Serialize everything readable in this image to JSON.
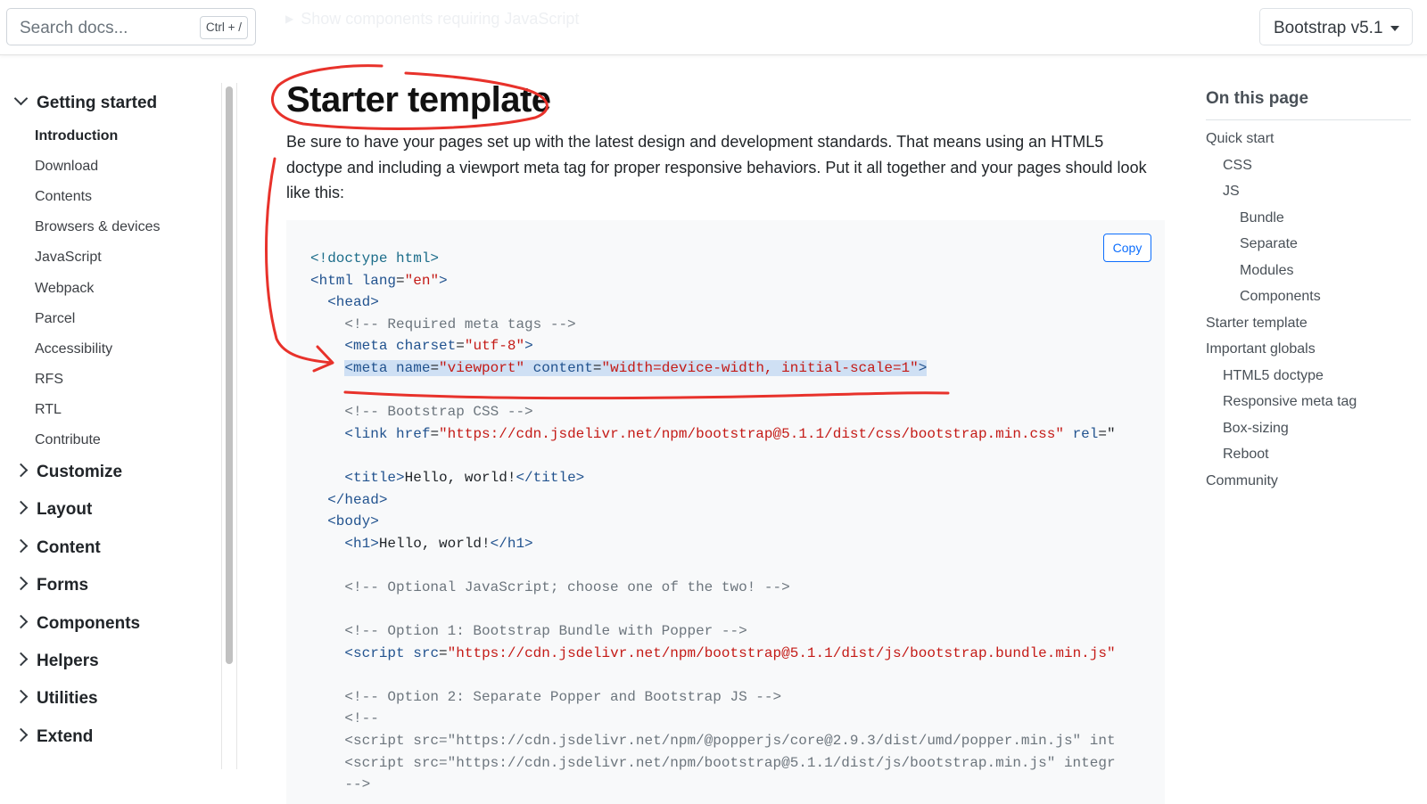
{
  "header": {
    "search_placeholder": "Search docs...",
    "search_shortcut": "Ctrl + /",
    "faded_link": "Show components requiring JavaScript",
    "version_label": "Bootstrap v5.1"
  },
  "sidebar": {
    "open_group": "Getting started",
    "items": [
      "Introduction",
      "Download",
      "Contents",
      "Browsers & devices",
      "JavaScript",
      "Webpack",
      "Parcel",
      "Accessibility",
      "RFS",
      "RTL",
      "Contribute"
    ],
    "active_item": "Introduction",
    "groups": [
      "Customize",
      "Layout",
      "Content",
      "Forms",
      "Components",
      "Helpers",
      "Utilities",
      "Extend"
    ]
  },
  "main": {
    "title": "Starter template",
    "intro": "Be sure to have your pages set up with the latest design and development standards. That means using an HTML5 doctype and including a viewport meta tag for proper responsive behaviors. Put it all together and your pages should look like this:",
    "copy_label": "Copy",
    "code_lines": [
      [
        {
          "t": "dt",
          "v": "<!doctype html>"
        }
      ],
      [
        {
          "t": "tg",
          "v": "<html"
        },
        {
          "t": "p",
          "v": " "
        },
        {
          "t": "at",
          "v": "lang"
        },
        {
          "t": "p",
          "v": "="
        },
        {
          "t": "st",
          "v": "\"en\""
        },
        {
          "t": "tg",
          "v": ">"
        }
      ],
      [
        {
          "t": "p",
          "v": "  "
        },
        {
          "t": "tg",
          "v": "<head>"
        }
      ],
      [
        {
          "t": "p",
          "v": "    "
        },
        {
          "t": "cm",
          "v": "<!-- Required meta tags -->"
        }
      ],
      [
        {
          "t": "p",
          "v": "    "
        },
        {
          "t": "tg",
          "v": "<meta"
        },
        {
          "t": "p",
          "v": " "
        },
        {
          "t": "at",
          "v": "charset"
        },
        {
          "t": "p",
          "v": "="
        },
        {
          "t": "st",
          "v": "\"utf-8\""
        },
        {
          "t": "tg",
          "v": ">"
        }
      ],
      [
        {
          "t": "p",
          "v": "    "
        },
        {
          "t": "tg",
          "v": "<meta",
          "h": 1
        },
        {
          "t": "p",
          "v": " ",
          "h": 1
        },
        {
          "t": "at",
          "v": "name",
          "h": 1
        },
        {
          "t": "p",
          "v": "=",
          "h": 1
        },
        {
          "t": "st",
          "v": "\"viewport\"",
          "h": 1
        },
        {
          "t": "p",
          "v": " ",
          "h": 1
        },
        {
          "t": "at",
          "v": "content",
          "h": 1
        },
        {
          "t": "p",
          "v": "=",
          "h": 1
        },
        {
          "t": "st",
          "v": "\"width=device-width, initial-scale=1\"",
          "h": 1
        },
        {
          "t": "tg",
          "v": ">",
          "h": 1
        }
      ],
      [],
      [
        {
          "t": "p",
          "v": "    "
        },
        {
          "t": "cm",
          "v": "<!-- Bootstrap CSS -->"
        }
      ],
      [
        {
          "t": "p",
          "v": "    "
        },
        {
          "t": "tg",
          "v": "<link"
        },
        {
          "t": "p",
          "v": " "
        },
        {
          "t": "at",
          "v": "href"
        },
        {
          "t": "p",
          "v": "="
        },
        {
          "t": "st",
          "v": "\"https://cdn.jsdelivr.net/npm/bootstrap@5.1.1/dist/css/bootstrap.min.css\""
        },
        {
          "t": "p",
          "v": " "
        },
        {
          "t": "at",
          "v": "rel"
        },
        {
          "t": "p",
          "v": "=\""
        }
      ],
      [],
      [
        {
          "t": "p",
          "v": "    "
        },
        {
          "t": "tg",
          "v": "<title>"
        },
        {
          "t": "p",
          "v": "Hello, world!"
        },
        {
          "t": "tg",
          "v": "</title>"
        }
      ],
      [
        {
          "t": "p",
          "v": "  "
        },
        {
          "t": "tg",
          "v": "</head>"
        }
      ],
      [
        {
          "t": "p",
          "v": "  "
        },
        {
          "t": "tg",
          "v": "<body>"
        }
      ],
      [
        {
          "t": "p",
          "v": "    "
        },
        {
          "t": "tg",
          "v": "<h1>"
        },
        {
          "t": "p",
          "v": "Hello, world!"
        },
        {
          "t": "tg",
          "v": "</h1>"
        }
      ],
      [],
      [
        {
          "t": "p",
          "v": "    "
        },
        {
          "t": "cm",
          "v": "<!-- Optional JavaScript; choose one of the two! -->"
        }
      ],
      [],
      [
        {
          "t": "p",
          "v": "    "
        },
        {
          "t": "cm",
          "v": "<!-- Option 1: Bootstrap Bundle with Popper -->"
        }
      ],
      [
        {
          "t": "p",
          "v": "    "
        },
        {
          "t": "tg",
          "v": "<script"
        },
        {
          "t": "p",
          "v": " "
        },
        {
          "t": "at",
          "v": "src"
        },
        {
          "t": "p",
          "v": "="
        },
        {
          "t": "st",
          "v": "\"https://cdn.jsdelivr.net/npm/bootstrap@5.1.1/dist/js/bootstrap.bundle.min.js\""
        }
      ],
      [],
      [
        {
          "t": "p",
          "v": "    "
        },
        {
          "t": "cm",
          "v": "<!-- Option 2: Separate Popper and Bootstrap JS -->"
        }
      ],
      [
        {
          "t": "p",
          "v": "    "
        },
        {
          "t": "cm",
          "v": "<!--"
        }
      ],
      [
        {
          "t": "p",
          "v": "    "
        },
        {
          "t": "cm",
          "v": "<script src=\"https://cdn.jsdelivr.net/npm/@popperjs/core@2.9.3/dist/umd/popper.min.js\" int"
        }
      ],
      [
        {
          "t": "p",
          "v": "    "
        },
        {
          "t": "cm",
          "v": "<script src=\"https://cdn.jsdelivr.net/npm/bootstrap@5.1.1/dist/js/bootstrap.min.js\" integr"
        }
      ],
      [
        {
          "t": "p",
          "v": "    "
        },
        {
          "t": "cm",
          "v": "-->"
        }
      ]
    ]
  },
  "toc": {
    "title": "On this page",
    "items": [
      {
        "label": "Quick start",
        "level": 0
      },
      {
        "label": "CSS",
        "level": 1
      },
      {
        "label": "JS",
        "level": 1
      },
      {
        "label": "Bundle",
        "level": 2
      },
      {
        "label": "Separate",
        "level": 2
      },
      {
        "label": "Modules",
        "level": 2
      },
      {
        "label": "Components",
        "level": 2
      },
      {
        "label": "Starter template",
        "level": 0
      },
      {
        "label": "Important globals",
        "level": 0
      },
      {
        "label": "HTML5 doctype",
        "level": 1
      },
      {
        "label": "Responsive meta tag",
        "level": 1
      },
      {
        "label": "Box-sizing",
        "level": 1
      },
      {
        "label": "Reboot",
        "level": 1
      },
      {
        "label": "Community",
        "level": 0
      }
    ]
  },
  "colors": {
    "accent": "#0d6efd",
    "annotation": "#e8322b",
    "highlight": "#cfe0f4"
  }
}
